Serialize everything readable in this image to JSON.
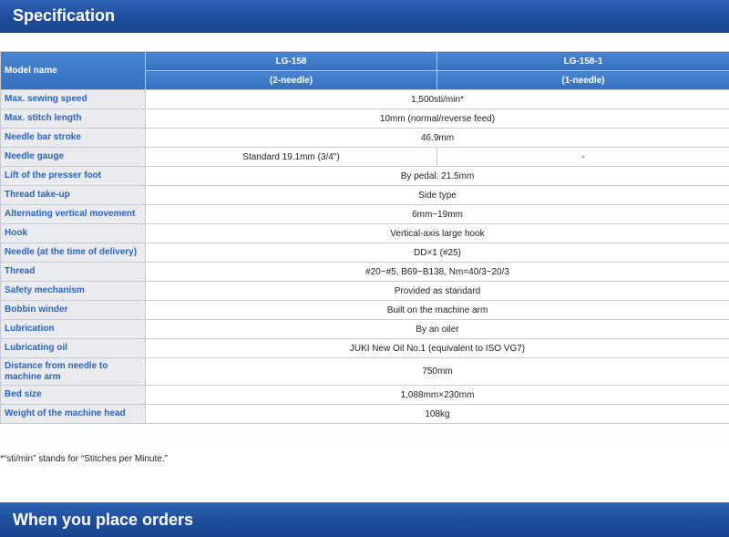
{
  "sections": {
    "specification_title": "Specification",
    "orders_title": "When you place orders"
  },
  "table": {
    "model_header": "Model name",
    "models": [
      {
        "name": "LG-158",
        "needle": "(2-needle)"
      },
      {
        "name": "LG-158-1",
        "needle": "(1-needle)"
      }
    ],
    "rows": [
      {
        "label": "Max. sewing speed",
        "value": "1,500sti/min*"
      },
      {
        "label": "Max. stitch length",
        "value": "10mm (normal/reverse feed)"
      },
      {
        "label": "Needle bar stroke",
        "value": "46.9mm"
      },
      {
        "label": "Needle gauge",
        "value_a": "Standard 19.1mm (3/4\")",
        "value_b": "-"
      },
      {
        "label": "Lift of the presser foot",
        "value": "By pedal: 21.5mm"
      },
      {
        "label": "Thread take-up",
        "value": "Side type"
      },
      {
        "label": "Alternating vertical movement",
        "value": "6mm~19mm"
      },
      {
        "label": "Hook",
        "value": "Vertical-axis large hook"
      },
      {
        "label": "Needle (at the time of delivery)",
        "value": "DD×1 (#25)"
      },
      {
        "label": "Thread",
        "value": "#20~#5, B69~B138, Nm=40/3~20/3"
      },
      {
        "label": "Safety mechanism",
        "value": "Provided as standard"
      },
      {
        "label": "Bobbin winder",
        "value": "Built on the machine arm"
      },
      {
        "label": "Lubrication",
        "value": "By an oiler"
      },
      {
        "label": "Lubricating oil",
        "value": "JUKI New Oil No.1 (equivalent to ISO VG7)"
      },
      {
        "label": "Distance from needle to machine arm",
        "value": "750mm"
      },
      {
        "label": "Bed size",
        "value": "1,088mm×230mm"
      },
      {
        "label": "Weight of the machine head",
        "value": "108kg"
      }
    ]
  },
  "footnote": "*“sti/min” stands for “Stitches per Minute.”"
}
